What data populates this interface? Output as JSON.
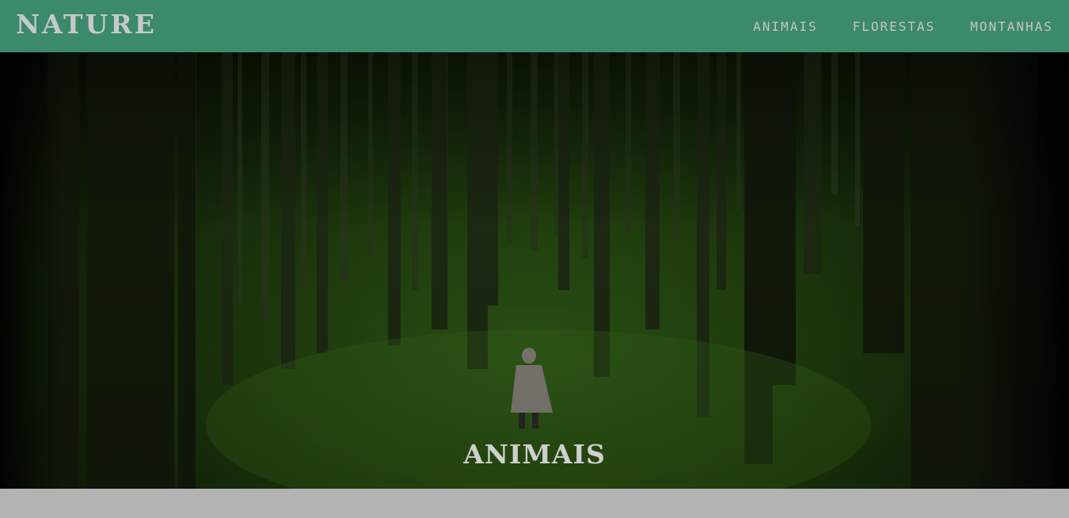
{
  "navbar": {
    "brand": "NATURE",
    "links": [
      "ANIMAIS",
      "FLORESTAS",
      "MONTANHAS"
    ]
  },
  "hero": {
    "title": "ANIMAIS",
    "image": "forest-hooded-figure"
  },
  "colors": {
    "navbar_bg": "#3b8a6a",
    "nav_text": "#c4c4c4",
    "page_bg": "#b3b3b3"
  }
}
